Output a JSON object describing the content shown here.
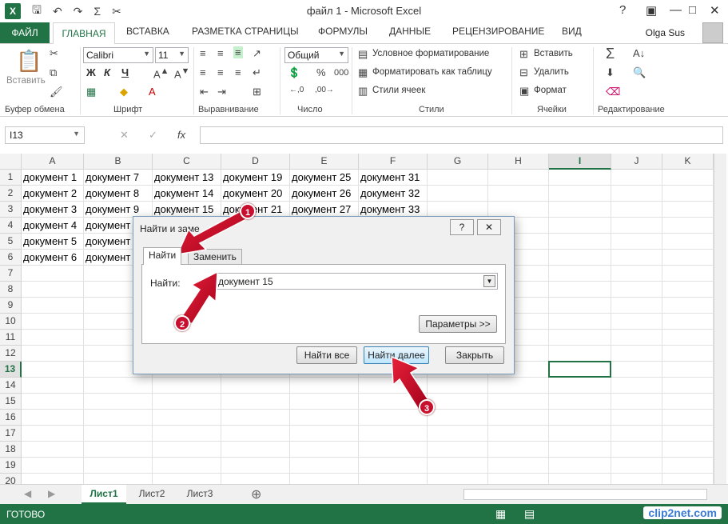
{
  "title": "файл 1 - Microsoft Excel",
  "ribbon_tabs": [
    "ФАЙЛ",
    "ГЛАВНАЯ",
    "ВСТАВКА",
    "РАЗМЕТКА СТРАНИЦЫ",
    "ФОРМУЛЫ",
    "ДАННЫЕ",
    "РЕЦЕНЗИРОВАНИЕ",
    "ВИД"
  ],
  "user": "Olga Sus",
  "ribbon": {
    "paste": "Вставить",
    "font_name": "Calibri",
    "font_size": "11",
    "bold": "Ж",
    "italic": "К",
    "underline": "Ч",
    "number_format": "Общий",
    "cond_format": "Условное форматирование",
    "format_table": "Форматировать как таблицу",
    "cell_styles": "Стили ячеек",
    "insert": "Вставить",
    "delete": "Удалить",
    "format": "Формат",
    "groups": [
      "Буфер обмена",
      "Шрифт",
      "Выравнивание",
      "Число",
      "Стили",
      "Ячейки",
      "Редактирование"
    ]
  },
  "formula_bar": {
    "name_box": "I13",
    "value": "",
    "fx": "fx"
  },
  "columns": [
    "A",
    "B",
    "C",
    "D",
    "E",
    "F",
    "G",
    "H",
    "I",
    "J",
    "K"
  ],
  "rows": [
    "1",
    "2",
    "3",
    "4",
    "5",
    "6",
    "7",
    "8",
    "9",
    "10",
    "11",
    "12",
    "13",
    "14",
    "15",
    "16",
    "17",
    "18",
    "19",
    "20"
  ],
  "cells": [
    [
      "документ 1",
      "документ 7",
      "документ 13",
      "документ 19",
      "документ 25",
      "документ 31"
    ],
    [
      "документ 2",
      "документ 8",
      "документ 14",
      "документ 20",
      "документ 26",
      "документ 32"
    ],
    [
      "документ 3",
      "документ 9",
      "документ 15",
      "документ 21",
      "документ 27",
      "документ 33"
    ],
    [
      "документ 4",
      "документ",
      "",
      "",
      "",
      ""
    ],
    [
      "документ 5",
      "документ",
      "",
      "",
      "",
      ""
    ],
    [
      "документ 6",
      "документ",
      "",
      "",
      "",
      ""
    ]
  ],
  "active_cell": "I13",
  "sheets": [
    "Лист1",
    "Лист2",
    "Лист3"
  ],
  "status": "ГОТОВО",
  "watermark": "clip2net.com",
  "dialog": {
    "title": "Найти и заме",
    "help": "?",
    "close_x": "✕",
    "tab_find": "Найти",
    "tab_replace": "Заменить",
    "find_label": "Найти:",
    "find_value": "документ 15",
    "params": "Параметры >>",
    "find_all": "Найти все",
    "find_next": "Найти далее",
    "close": "Закрыть"
  },
  "callouts": [
    "1",
    "2",
    "3"
  ],
  "colors": {
    "excel_green": "#217346",
    "callout_red": "#c8102e"
  }
}
